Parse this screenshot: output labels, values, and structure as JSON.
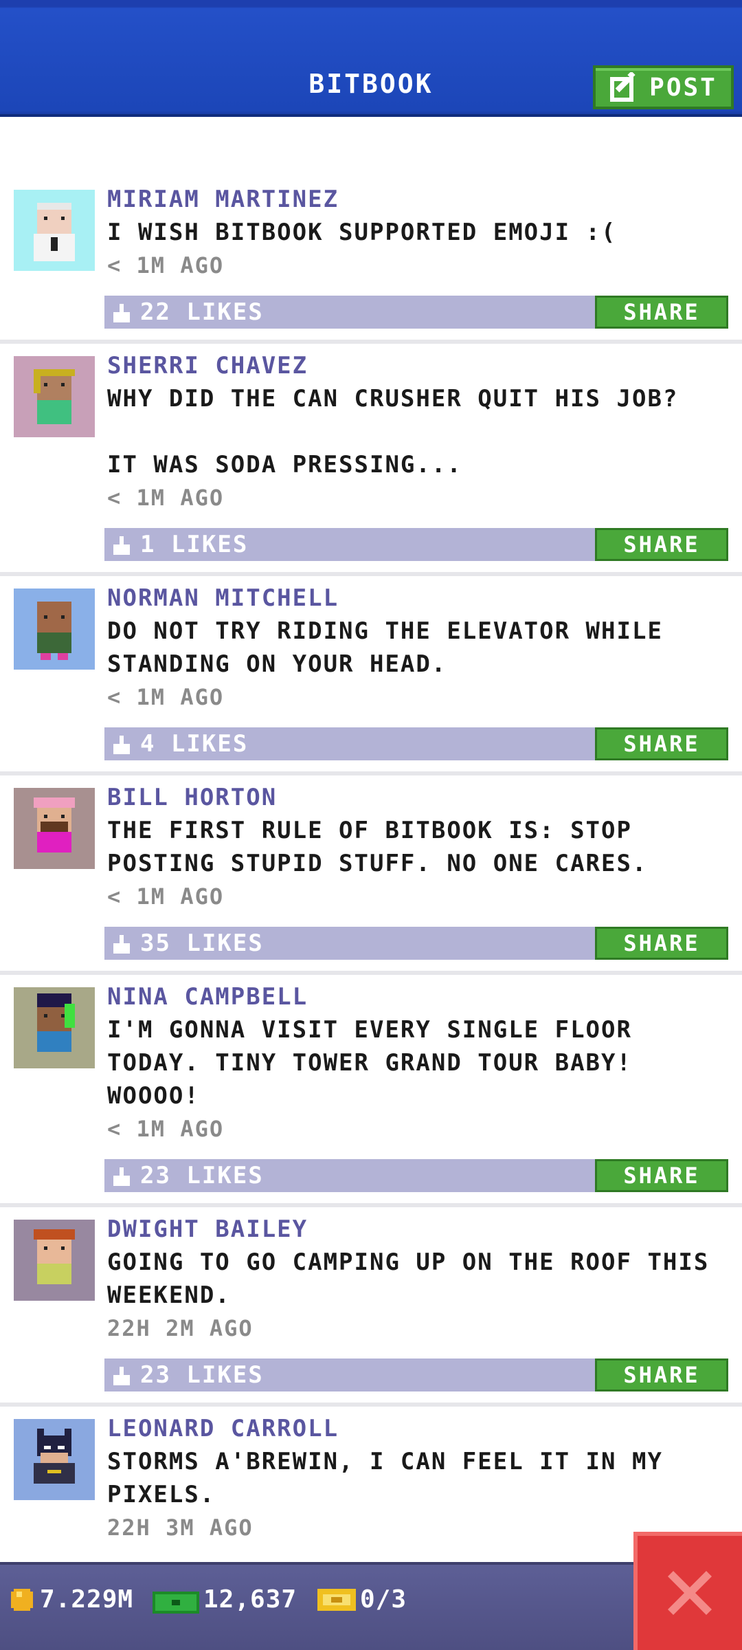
{
  "header": {
    "title": "BITBOOK",
    "post_label": "POST"
  },
  "share_label": "SHARE",
  "posts": [
    {
      "author": "MIRIAM MARTINEZ",
      "message": "I WISH BITBOOK SUPPORTED EMOJI :(",
      "time": "< 1M AGO",
      "likes": "22 LIKES",
      "avatar_bg": "#a8f0f4"
    },
    {
      "author": "SHERRI CHAVEZ",
      "message": "WHY DID THE CAN CRUSHER QUIT HIS JOB?\n\nIT WAS SODA PRESSING...",
      "time": "< 1M AGO",
      "likes": "1 LIKES",
      "avatar_bg": "#c8a0b8"
    },
    {
      "author": "NORMAN MITCHELL",
      "message": "DO NOT TRY RIDING THE ELEVATOR WHILE\nSTANDING ON YOUR HEAD.",
      "time": "< 1M AGO",
      "likes": "4 LIKES",
      "avatar_bg": "#8ab0e8"
    },
    {
      "author": "BILL HORTON",
      "message": "THE FIRST RULE OF BITBOOK IS: STOP\nPOSTING STUPID STUFF. NO ONE CARES.",
      "time": "< 1M AGO",
      "likes": "35 LIKES",
      "avatar_bg": "#a89090"
    },
    {
      "author": "NINA CAMPBELL",
      "message": "I'M GONNA VISIT EVERY SINGLE FLOOR\nTODAY. TINY TOWER GRAND TOUR BABY!\nWOOOO!",
      "time": "< 1M AGO",
      "likes": "23 LIKES",
      "avatar_bg": "#a8a888"
    },
    {
      "author": "DWIGHT BAILEY",
      "message": "GOING TO GO CAMPING UP ON THE ROOF THIS\nWEEKEND.",
      "time": "22H 2M AGO",
      "likes": "23 LIKES",
      "avatar_bg": "#9888a0"
    },
    {
      "author": "LEONARD CARROLL",
      "message": "STORMS A'BREWIN, I CAN FEEL IT IN MY\nPIXELS.",
      "time": "22H 3M AGO",
      "likes": "",
      "avatar_bg": "#8aa8e0"
    }
  ],
  "status": {
    "coins": "7.229M",
    "bux": "12,637",
    "tickets": "0/3"
  },
  "colors": {
    "header": "#1c46b8",
    "accent_green": "#4aa83a",
    "author": "#5a56a0",
    "like_bar": "#b3b3d6",
    "close_red": "#e0383a"
  }
}
